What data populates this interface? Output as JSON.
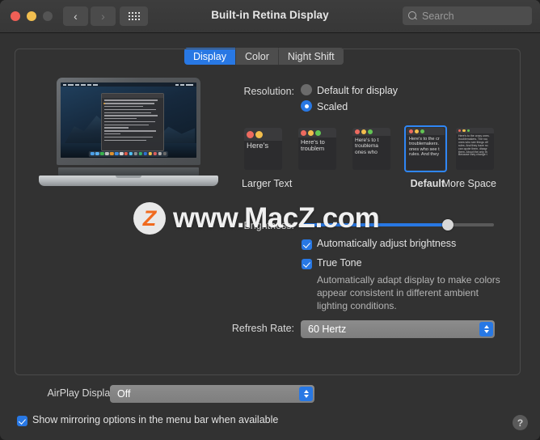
{
  "window": {
    "title": "Built-in Retina Display",
    "traffic_lights": [
      "close",
      "minimize",
      "zoom"
    ],
    "nav_back_icon": "chevron-left-icon",
    "nav_forward_icon": "chevron-right-icon",
    "grid_icon": "show-all-grid-icon"
  },
  "search": {
    "placeholder": "Search",
    "value": "",
    "icon": "search-icon"
  },
  "tabs": [
    {
      "label": "Display",
      "active": true
    },
    {
      "label": "Color",
      "active": false
    },
    {
      "label": "Night Shift",
      "active": false
    }
  ],
  "resolution": {
    "label": "Resolution:",
    "options": [
      {
        "label": "Default for display",
        "selected": false
      },
      {
        "label": "Scaled",
        "selected": true
      }
    ]
  },
  "scaled_thumbnails": {
    "items": [
      {
        "name": "larger-text-1",
        "text": "Here's",
        "selected": false
      },
      {
        "name": "larger-text-2",
        "text": "Here's to troublem",
        "selected": false
      },
      {
        "name": "mid-1",
        "text": "Here's to t troublema ones who",
        "selected": false
      },
      {
        "name": "default",
        "text": "Here's to the cr troublemakers. ones who see t rules. And they",
        "selected": true
      },
      {
        "name": "more-space",
        "text": "Here's to the crazy ones. troublemakers. The rou ones who see things dif rules. And they have no can quote them, disagr them. About the only th Because they change t",
        "selected": false
      }
    ],
    "left_label": "Larger Text",
    "selected_label": "Default",
    "right_label": "More Space"
  },
  "brightness": {
    "label": "Brightness:",
    "value_percent": 76,
    "auto_adjust": {
      "label": "Automatically adjust brightness",
      "checked": true
    }
  },
  "true_tone": {
    "label": "True Tone",
    "checked": true,
    "description": "Automatically adapt display to make colors appear consistent in different ambient lighting conditions."
  },
  "refresh_rate": {
    "label": "Refresh Rate:",
    "value": "60 Hertz"
  },
  "airplay": {
    "label": "AirPlay Display:",
    "value": "Off",
    "show_mirroring": {
      "label": "Show mirroring options in the menu bar when available",
      "checked": true
    }
  },
  "help": {
    "label": "?"
  },
  "watermark": {
    "logo": "Z",
    "text": "www.MacZ.com"
  },
  "colors": {
    "accent": "#2878e4",
    "selection_border": "#2f86f5",
    "window_bg": "#323232",
    "titlebar_bg": "#3d3d3d",
    "close": "#ef5f56",
    "minimize": "#f1be4f",
    "zoom_disabled": "#545454",
    "watermark_logo": "#f06a1e"
  }
}
